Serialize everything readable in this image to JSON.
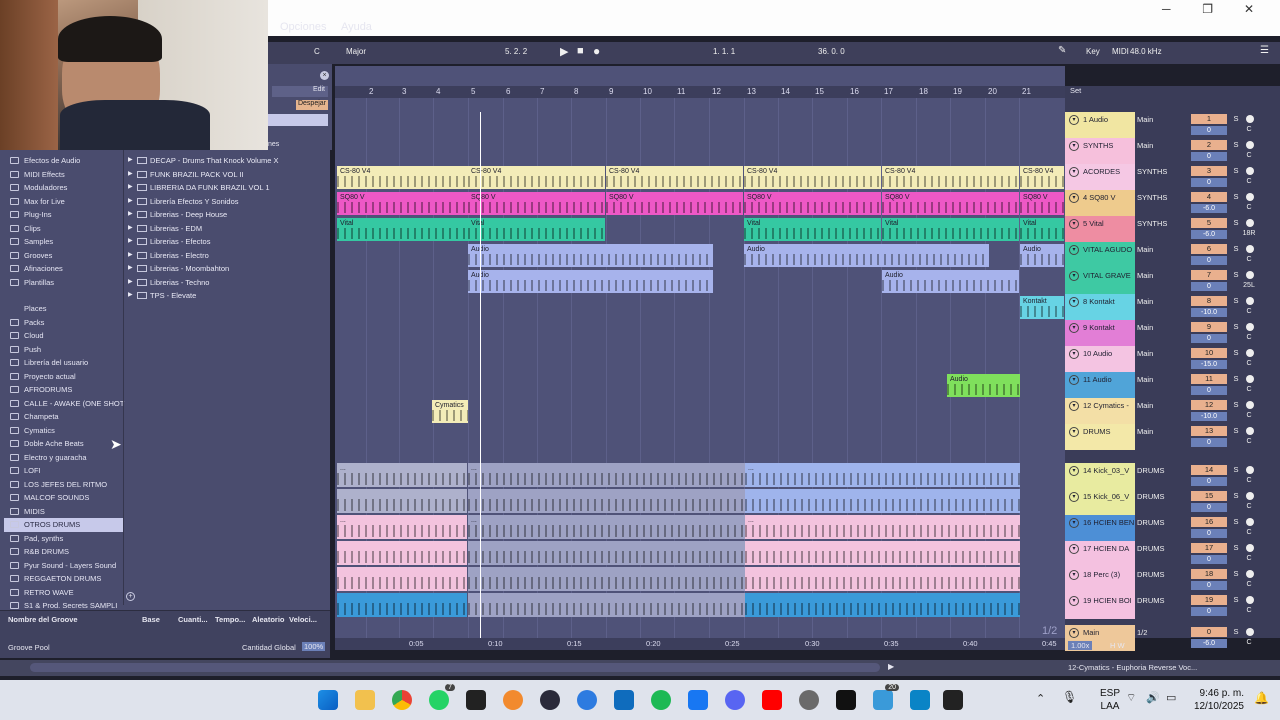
{
  "menu": {
    "items": [
      "Opciones",
      "Ayuda"
    ],
    "window_buttons": [
      "─",
      "❐",
      "✕"
    ]
  },
  "transport": {
    "scale_root": "C",
    "scale_mode": "Major",
    "position": "5.   2.   2",
    "loop_start": "1.   1.   1",
    "loop_length": "36.   0.   0",
    "key": "Key",
    "midi": "MIDI",
    "sample_rate": "48.0 kHz"
  },
  "browser": {
    "edit": "Edit",
    "clear": "Despejar",
    "label_fragment": "nes",
    "categories": [
      "Efectos de Audio",
      "MIDI Effects",
      "Moduladores",
      "Max for Live",
      "Plug-Ins",
      "Clips",
      "Samples",
      "Grooves",
      "Afinaciones",
      "Plantillas"
    ],
    "places": [
      "Places",
      "Packs",
      "Cloud",
      "Push",
      "Librería del usuario",
      "Proyecto actual",
      "AFRODRUMS",
      "CALLE - AWAKE (ONE SHOT",
      "Champeta",
      "Cymatics",
      "Doble Ache Beats",
      "Electro y guaracha",
      "LOFI",
      "LOS JEFES DEL RITMO",
      "MALCOF SOUNDS",
      "MIDIS",
      "OTROS DRUMS",
      "Pad, synths",
      "R&B DRUMS",
      "Pyur Sound - Layers Sound",
      "REGGAETON DRUMS",
      "RETRO WAVE",
      "S1 & Prod. Secrets SAMPLI"
    ],
    "selected_place": "OTROS DRUMS",
    "folders": [
      "DECAP - Drums That Knock Volume X",
      "FUNK BRAZIL PACK VOL II",
      "LIBRERIA DA FUNK BRAZIL VOL 1",
      "Librería Efectos Y Sonidos",
      "Librerias - Deep House",
      "Librerias - EDM",
      "Librerias - Efectos",
      "Librerias - Electro",
      "Librerias - Moombahton",
      "Librerias - Techno",
      "TPS - Elevate"
    ],
    "groove_headers": [
      "Nombre del Groove",
      "Base",
      "Cuanti...",
      "Tempo...",
      "Aleatorio",
      "Veloci..."
    ],
    "groove_pool": "Groove Pool",
    "global_amount_label": "Cantidad Global",
    "global_amount_value": "100%"
  },
  "arrangement": {
    "bars": [
      "2",
      "3",
      "4",
      "5",
      "6",
      "7",
      "8",
      "9",
      "10",
      "11",
      "12",
      "13",
      "14",
      "15",
      "16",
      "17",
      "18",
      "19",
      "20",
      "21"
    ],
    "times": [
      "0:05",
      "0:10",
      "0:15",
      "0:20",
      "0:25",
      "0:30",
      "0:35",
      "0:40",
      "0:45"
    ],
    "set_label": "Set",
    "page": "1/2",
    "clip_names": {
      "cs80": "CS-80 V4",
      "sq80": "SQ80 V",
      "vital": "Vital",
      "audio": "Audio",
      "kontakt": "Kontakt",
      "cymatics": "Cymatics"
    },
    "dotted": "..."
  },
  "tracks": [
    {
      "name": "1 Audio",
      "route": "Main",
      "num": "1",
      "vol": "0",
      "color": "#f1e6a2"
    },
    {
      "name": "SYNTHS",
      "route": "Main",
      "num": "2",
      "vol": "0",
      "color": "#f6c0dc"
    },
    {
      "name": "ACORDES",
      "route": "SYNTHS",
      "num": "3",
      "vol": "0",
      "color": "#f5c8e4"
    },
    {
      "name": "4 SQ80 V",
      "route": "SYNTHS",
      "num": "4",
      "vol": "-6.0",
      "color": "#eecb8d"
    },
    {
      "name": "5 Vital",
      "route": "SYNTHS",
      "num": "5",
      "vol": "-6.0",
      "pan": "18R",
      "color": "#ee8da2"
    },
    {
      "name": "VITAL AGUDO",
      "route": "Main",
      "num": "6",
      "vol": "0",
      "color": "#3ec9a3"
    },
    {
      "name": "VITAL GRAVE",
      "route": "Main",
      "num": "7",
      "vol": "0",
      "pan": "25L",
      "color": "#3ec9a3"
    },
    {
      "name": "8 Kontakt",
      "route": "Main",
      "num": "8",
      "vol": "-10.0",
      "color": "#67d3e4"
    },
    {
      "name": "9 Kontakt",
      "route": "Main",
      "num": "9",
      "vol": "0",
      "color": "#e27ed6"
    },
    {
      "name": "10 Audio",
      "route": "Main",
      "num": "10",
      "vol": "-15.0",
      "color": "#f4c4e2"
    },
    {
      "name": "11 Audio",
      "route": "Main",
      "num": "11",
      "vol": "0",
      "color": "#50a4d8"
    },
    {
      "name": "12 Cymatics -",
      "route": "Main",
      "num": "12",
      "vol": "-10.0",
      "color": "#f3dfa6"
    },
    {
      "name": "DRUMS",
      "route": "Main",
      "num": "13",
      "vol": "0",
      "color": "#f3e8a8"
    },
    {
      "name": "14 Kick_03_V",
      "route": "DRUMS",
      "num": "14",
      "vol": "0",
      "color": "#e8eba0"
    },
    {
      "name": "15 Kick_06_V",
      "route": "DRUMS",
      "num": "15",
      "vol": "0",
      "color": "#e8eba0"
    },
    {
      "name": "16 HCIEN BEN",
      "route": "DRUMS",
      "num": "16",
      "vol": "0",
      "color": "#4d8fd6"
    },
    {
      "name": "17 HCIEN DA",
      "route": "DRUMS",
      "num": "17",
      "vol": "0",
      "color": "#f4c1e0"
    },
    {
      "name": "18 Perc (3)",
      "route": "DRUMS",
      "num": "18",
      "vol": "0",
      "color": "#f4c1e0"
    },
    {
      "name": "19 HCIEN BOI",
      "route": "DRUMS",
      "num": "19",
      "vol": "0",
      "color": "#f4c1e0"
    },
    {
      "name": "Main",
      "route": "1/2",
      "num": "0",
      "vol": "-6.0",
      "color": "#eec89a"
    }
  ],
  "mixer": {
    "solo": "S",
    "cue": "C"
  },
  "status": {
    "zoom": "1.00x",
    "hw": "H  W",
    "clip_info": "12-Cymatics - Euphoria Reverse Voc..."
  },
  "taskbar": {
    "lang_top": "ESP",
    "lang_bottom": "LAA",
    "time": "9:46 p. m.",
    "date": "12/10/2025",
    "badge_whatsapp": "7",
    "badge_mail": "20"
  }
}
